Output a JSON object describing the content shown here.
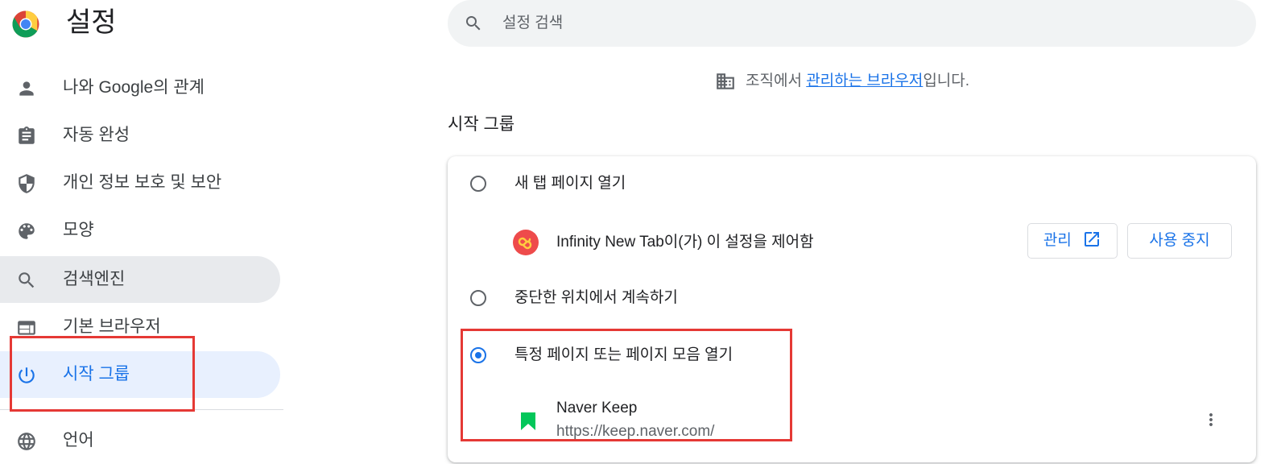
{
  "header": {
    "title": "설정",
    "search_placeholder": "설정 검색"
  },
  "sidebar": {
    "items": [
      {
        "label": "나와 Google의 관계",
        "icon": "person-icon"
      },
      {
        "label": "자동 완성",
        "icon": "clipboard-icon"
      },
      {
        "label": "개인 정보 보호 및 보안",
        "icon": "shield-icon"
      },
      {
        "label": "모양",
        "icon": "palette-icon"
      },
      {
        "label": "검색엔진",
        "icon": "search-icon"
      },
      {
        "label": "기본 브라우저",
        "icon": "browser-icon"
      },
      {
        "label": "시작 그룹",
        "icon": "power-icon"
      },
      {
        "label": "언어",
        "icon": "globe-icon"
      }
    ]
  },
  "managed": {
    "prefix": "조직에서 ",
    "link": "관리하는 브라우저",
    "suffix": "입니다."
  },
  "startup": {
    "section_title": "시작 그룹",
    "options": [
      {
        "label": "새 탭 페이지 열기",
        "checked": false
      },
      {
        "label": "중단한 위치에서 계속하기",
        "checked": false
      },
      {
        "label": "특정 페이지 또는 페이지 모음 열기",
        "checked": true
      }
    ],
    "extension_notice": "Infinity New Tab이(가) 이 설정을 제어함",
    "manage_button": "관리",
    "disable_button": "사용 중지",
    "pages": [
      {
        "name": "Naver Keep",
        "url": "https://keep.naver.com/"
      }
    ]
  },
  "colors": {
    "accent": "#1a73e8",
    "highlight": "#e53935",
    "nav_active_bg": "#e8f0fe",
    "nav_hover_bg": "#e8eaed"
  }
}
